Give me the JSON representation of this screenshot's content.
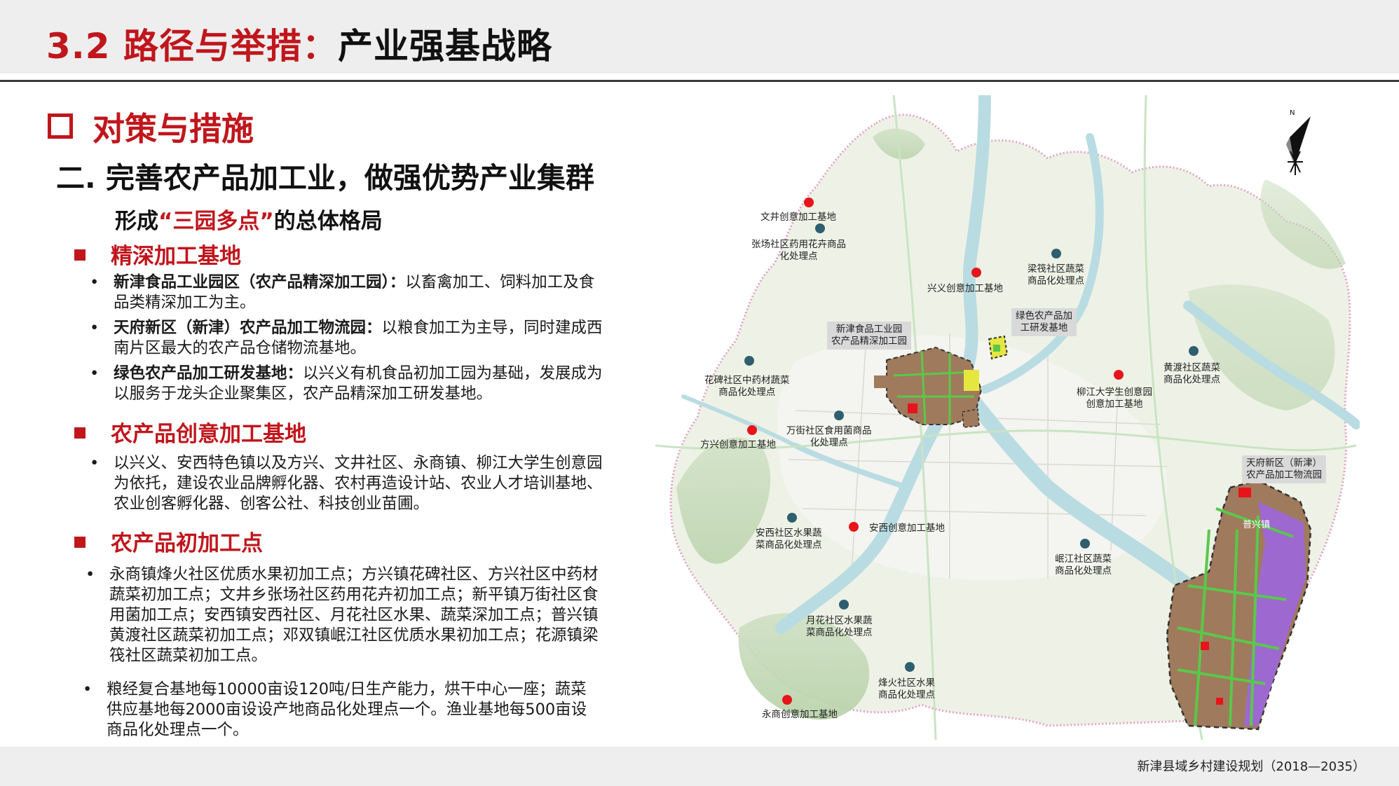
{
  "header": {
    "title_red": "3.2 路径与举措：",
    "title_dark": "产业强基战略"
  },
  "section": {
    "heading": "对策与措施",
    "subheading": "二. 完善农产品加工业，做强优势产业集群",
    "pattern_prefix": "形成",
    "pattern_quote": "“三园多点”",
    "pattern_suffix": "的总体格局"
  },
  "categories": [
    {
      "title": "精深加工基地",
      "items": [
        {
          "bold": "新津食品工业园区（农产品精深加工园）：",
          "text": "以畜禽加工、饲料加工及食品类精深加工为主。"
        },
        {
          "bold": "天府新区（新津）农产品加工物流园：",
          "text": "以粮食加工为主导，同时建成西南片区最大的农产品仓储物流基地。"
        },
        {
          "bold": "绿色农产品加工研发基地：",
          "text": "以兴义有机食品初加工园为基础，发展成为以服务于龙头企业聚集区，农产品精深加工研发基地。"
        }
      ]
    },
    {
      "title": "农产品创意加工基地",
      "items": [
        {
          "bold": "",
          "text": "以兴义、安西特色镇以及方兴、文井社区、永商镇、柳江大学生创意园为依托，建设农业品牌孵化器、农村再造设计站、农业人才培训基地、农业创客孵化器、创客公社、科技创业苗圃。"
        }
      ]
    },
    {
      "title": "农产品初加工点",
      "items": [
        {
          "bold": "",
          "text": "永商镇烽火社区优质水果初加工点；方兴镇花碑社区、方兴社区中药材蔬菜初加工点；文井乡张场社区药用花卉初加工点；新平镇万街社区食用菌加工点；安西镇安西社区、月花社区水果、蔬菜深加工点；普兴镇黄渡社区蔬菜初加工点；邓双镇岷江社区优质水果初加工点；花源镇梁筏社区蔬菜初加工点。"
        },
        {
          "bold": "",
          "text": "粮经复合基地每10000亩设120吨/日生产能力，烘干中心一座；蔬菜供应基地每2000亩设设产地商品化处理点一个。渔业基地每500亩设商品化处理点一个。"
        }
      ]
    }
  ],
  "map": {
    "north_label": "N",
    "town_label": "普兴镇",
    "labels": [
      {
        "text": "文井创意加工基地"
      },
      {
        "text": "张场社区药用花卉商品\n化处理点"
      },
      {
        "text": "兴义创意加工基地"
      },
      {
        "text": "梁筏社区蔬菜\n商品化处理点"
      },
      {
        "text": "新津食品工业园\n农产品精深加工园",
        "boxed": true
      },
      {
        "text": "绿色农产品加\n工研发基地",
        "boxed": true
      },
      {
        "text": "花碑社区中药材蔬菜\n商品化处理点"
      },
      {
        "text": "黄渡社区蔬菜\n商品化处理点"
      },
      {
        "text": "柳江大学生创意园\n创意加工基地"
      },
      {
        "text": "万街社区食用菌商品\n化处理点"
      },
      {
        "text": "方兴创意加工基地"
      },
      {
        "text": "天府新区（新津）\n农产品加工物流园",
        "boxed": true
      },
      {
        "text": "安西社区水果蔬\n菜商品化处理点"
      },
      {
        "text": "安西创意加工基地"
      },
      {
        "text": "岷江社区蔬菜\n商品化处理点"
      },
      {
        "text": "月花社区水果蔬\n菜商品化处理点"
      },
      {
        "text": "烽火社区水果\n商品化处理点"
      },
      {
        "text": "永商创意加工基地"
      }
    ],
    "colors": {
      "red_point": "#e8141b",
      "teal_point": "#2f5f6e"
    }
  },
  "footer": {
    "text": "新津县域乡村建设规划（2018—2035）"
  }
}
